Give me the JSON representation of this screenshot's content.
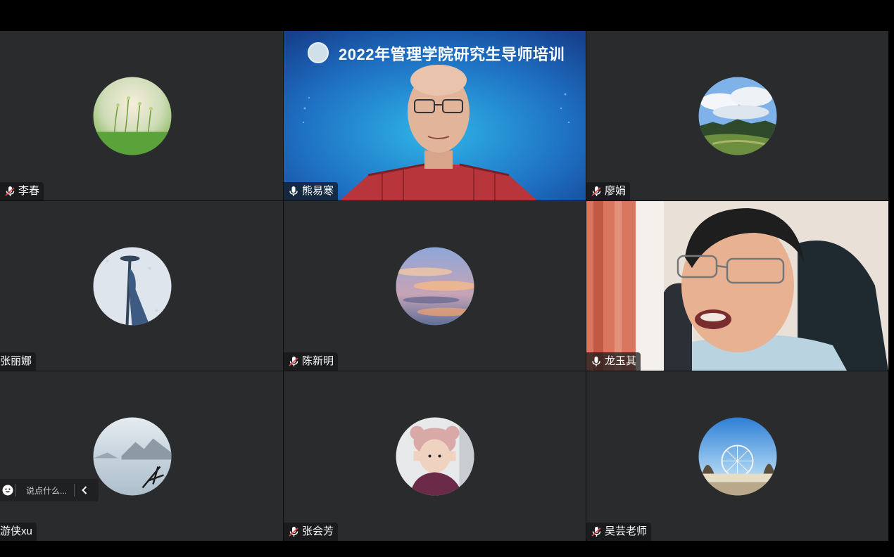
{
  "participants": [
    {
      "name": "李春",
      "mic": "muted",
      "avatar": "meadow-sprouts"
    },
    {
      "name": "熊易寒",
      "mic": "on",
      "video": true,
      "banner": "2022年管理学院研究生导师培训"
    },
    {
      "name": "廖娟",
      "mic": "muted",
      "avatar": "sky-landscape"
    },
    {
      "name": "张丽娜",
      "mic": "none",
      "avatar": "snow-shadow"
    },
    {
      "name": "陈新明",
      "mic": "muted",
      "avatar": "sunset-clouds"
    },
    {
      "name": "龙玉其",
      "mic": "on",
      "video": true,
      "active_speaker": true
    },
    {
      "name": "游侠xu",
      "mic": "none",
      "avatar": "misty-lake"
    },
    {
      "name": "张会芳",
      "mic": "muted",
      "avatar": "child-photo"
    },
    {
      "name": "吴芸老师",
      "mic": "muted",
      "avatar": "ferris-wheel"
    }
  ],
  "chat": {
    "placeholder": "说点什么...",
    "emoji_icon": "smiley-icon",
    "collapse_icon": "chevron-left-icon"
  },
  "colors": {
    "tile_bg": "#2a2b2d",
    "active_speaker_border": "#20c35b",
    "banner_bg": "#1c4f98"
  }
}
